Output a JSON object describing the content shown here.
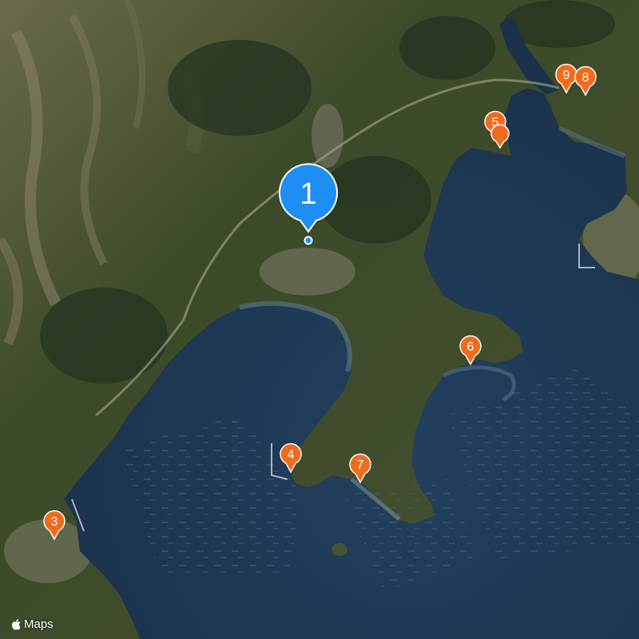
{
  "map": {
    "style": "satellite",
    "colors": {
      "pin_orange": "#f26a1b",
      "pin_blue": "#1e8ef5",
      "water": "#1e3450",
      "land": "#3f4a2c"
    }
  },
  "markers": [
    {
      "id": "1",
      "label": "1",
      "color": "#1e8ef5",
      "kind": "selected"
    },
    {
      "id": "3",
      "label": "3",
      "color": "#f26a1b",
      "kind": "place"
    },
    {
      "id": "4",
      "label": "4",
      "color": "#f26a1b",
      "kind": "place"
    },
    {
      "id": "5",
      "label": "5",
      "color": "#f26a1b",
      "kind": "place"
    },
    {
      "id": "6",
      "label": "6",
      "color": "#f26a1b",
      "kind": "place"
    },
    {
      "id": "7",
      "label": "7",
      "color": "#f26a1b",
      "kind": "place"
    },
    {
      "id": "8",
      "label": "8",
      "color": "#f26a1b",
      "kind": "place"
    },
    {
      "id": "9",
      "label": "9",
      "color": "#f26a1b",
      "kind": "place"
    }
  ],
  "attribution": {
    "logo_icon": "apple-logo-icon",
    "text": "Maps"
  }
}
